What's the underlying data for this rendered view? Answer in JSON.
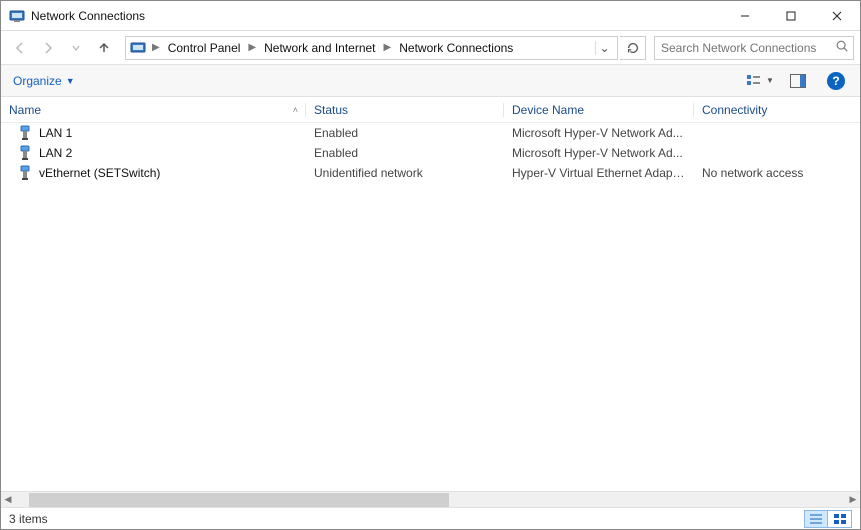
{
  "window": {
    "title": "Network Connections"
  },
  "breadcrumb": {
    "items": [
      "Control Panel",
      "Network and Internet",
      "Network Connections"
    ]
  },
  "search": {
    "placeholder": "Search Network Connections"
  },
  "toolbar": {
    "organize_label": "Organize"
  },
  "columns": {
    "name": "Name",
    "status": "Status",
    "device": "Device Name",
    "connectivity": "Connectivity"
  },
  "rows": [
    {
      "name": "LAN 1",
      "status": "Enabled",
      "device": "Microsoft Hyper-V Network Ad...",
      "connectivity": ""
    },
    {
      "name": "LAN 2",
      "status": "Enabled",
      "device": "Microsoft Hyper-V Network Ad...",
      "connectivity": ""
    },
    {
      "name": "vEthernet (SETSwitch)",
      "status": "Unidentified network",
      "device": "Hyper-V Virtual Ethernet Adapter",
      "connectivity": "No network access"
    }
  ],
  "status_bar": {
    "item_count": "3 items"
  }
}
